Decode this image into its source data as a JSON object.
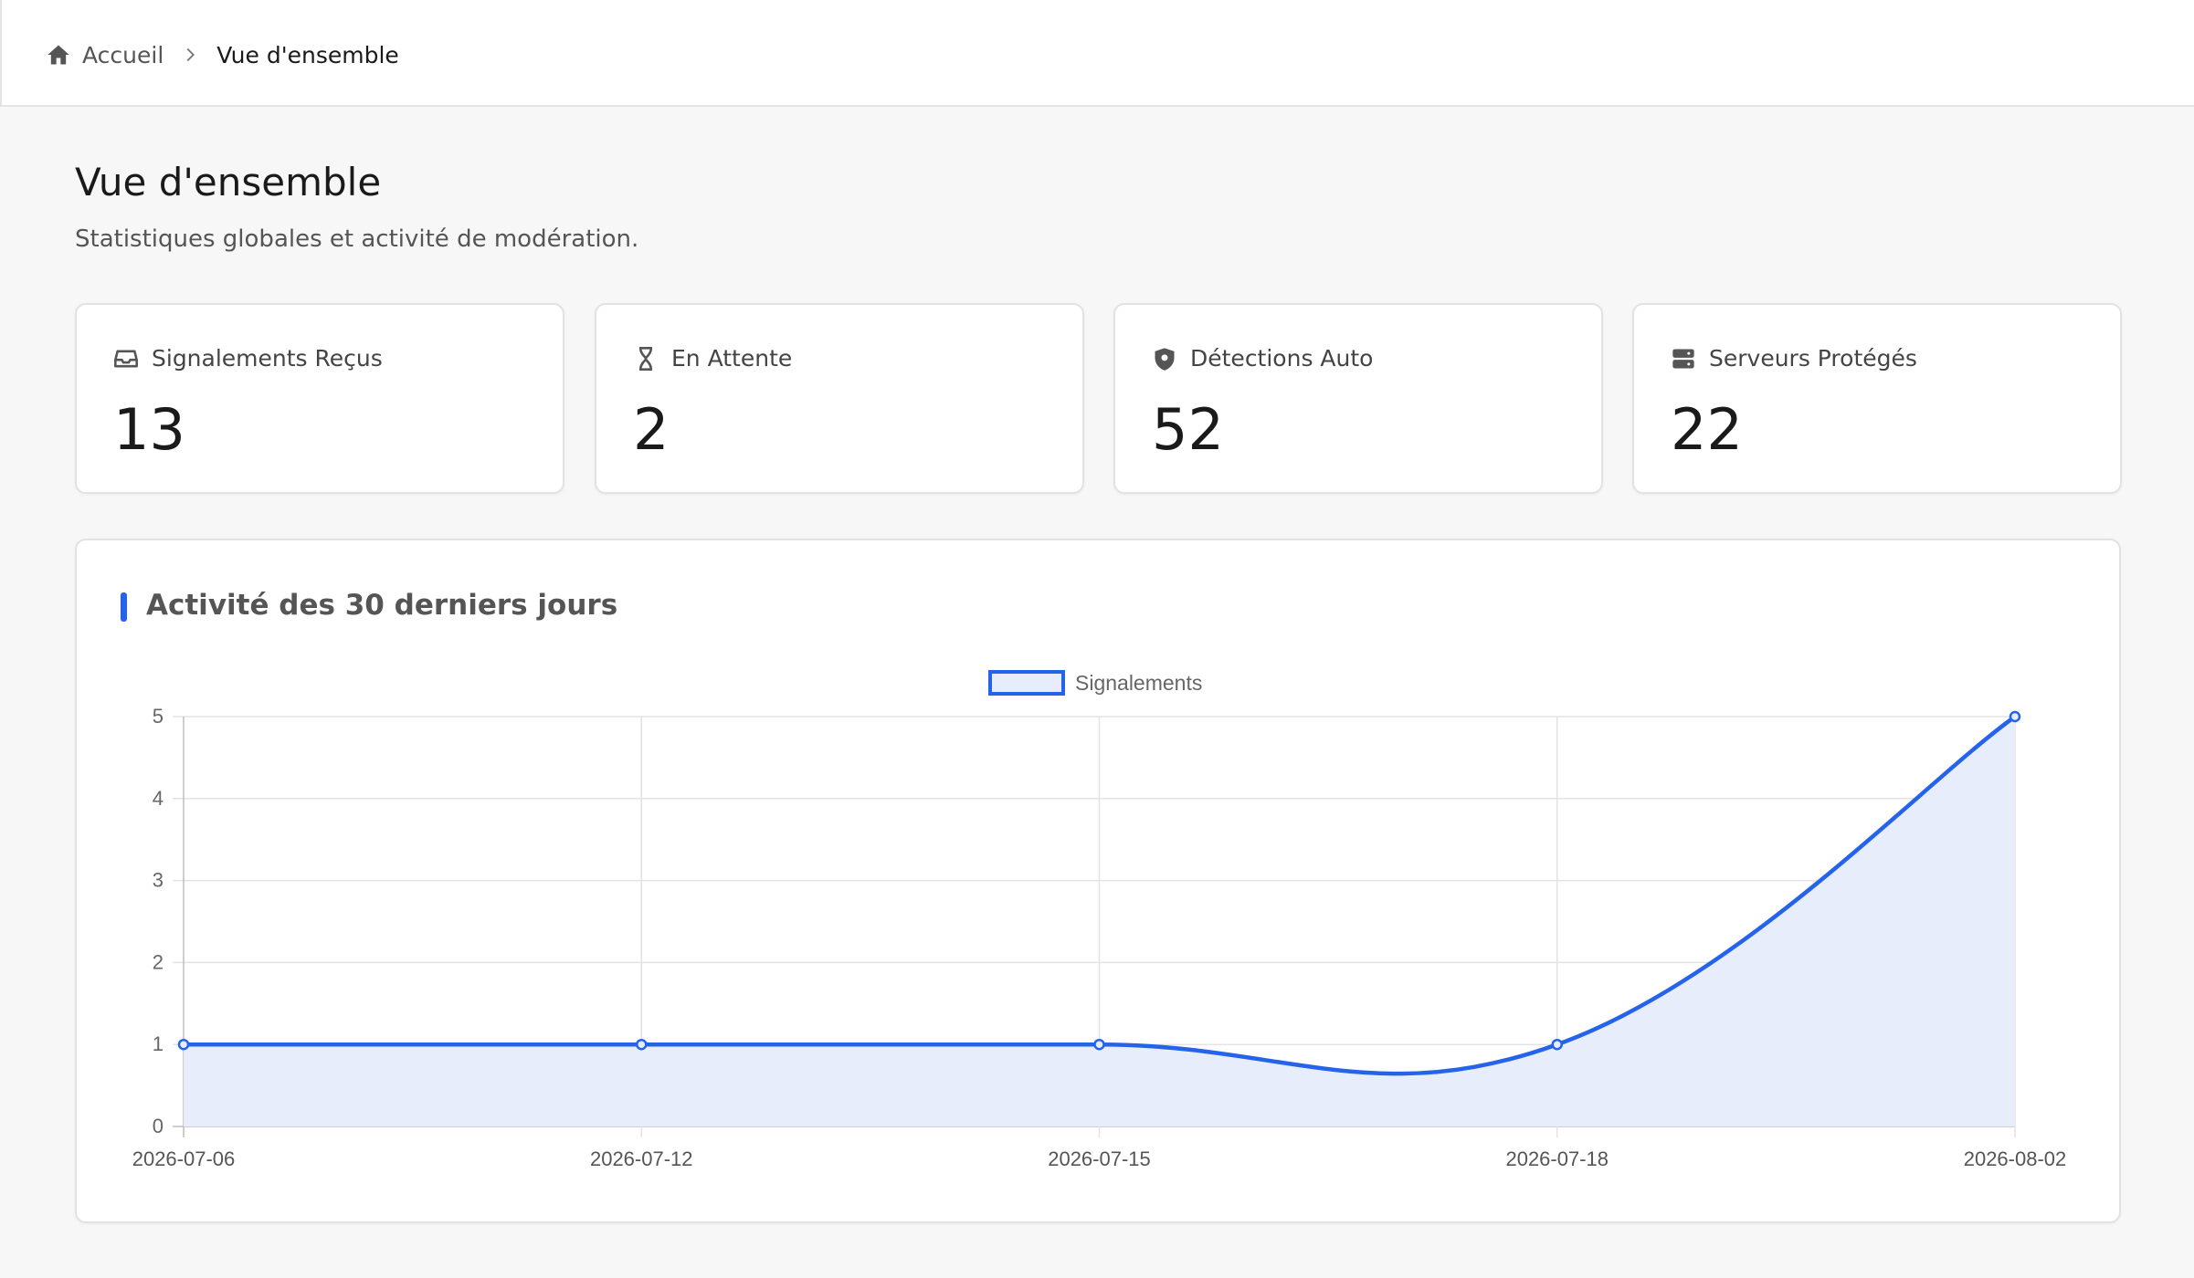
{
  "breadcrumb": {
    "home_label": "Accueil",
    "current_label": "Vue d'ensemble",
    "home_icon": "home-icon",
    "separator_icon": "chevron-right-icon"
  },
  "header": {
    "title": "Vue d'ensemble",
    "subtitle": "Statistiques globales et activité de modération."
  },
  "stats": [
    {
      "label": "Signalements Reçus",
      "value": "13",
      "icon": "inbox-icon"
    },
    {
      "label": "En Attente",
      "value": "2",
      "icon": "hourglass-icon"
    },
    {
      "label": "Détections Auto",
      "value": "52",
      "icon": "shield-icon"
    },
    {
      "label": "Serveurs Protégés",
      "value": "22",
      "icon": "server-icon"
    }
  ],
  "activity": {
    "title": "Activité des 30 derniers jours",
    "accent_color": "#2563eb"
  },
  "chart_data": {
    "type": "line",
    "x": [
      "2026-07-06",
      "2026-07-12",
      "2026-07-15",
      "2026-07-18",
      "2026-08-02"
    ],
    "series": [
      {
        "name": "Signalements",
        "values": [
          1,
          1,
          1,
          1,
          5
        ],
        "color": "#2563eb",
        "fill": "#e7edfb"
      }
    ],
    "ylim": [
      0,
      5
    ],
    "yticks": [
      "0",
      "1",
      "2",
      "3",
      "4",
      "5"
    ],
    "grid": true,
    "legend": "top-center"
  }
}
